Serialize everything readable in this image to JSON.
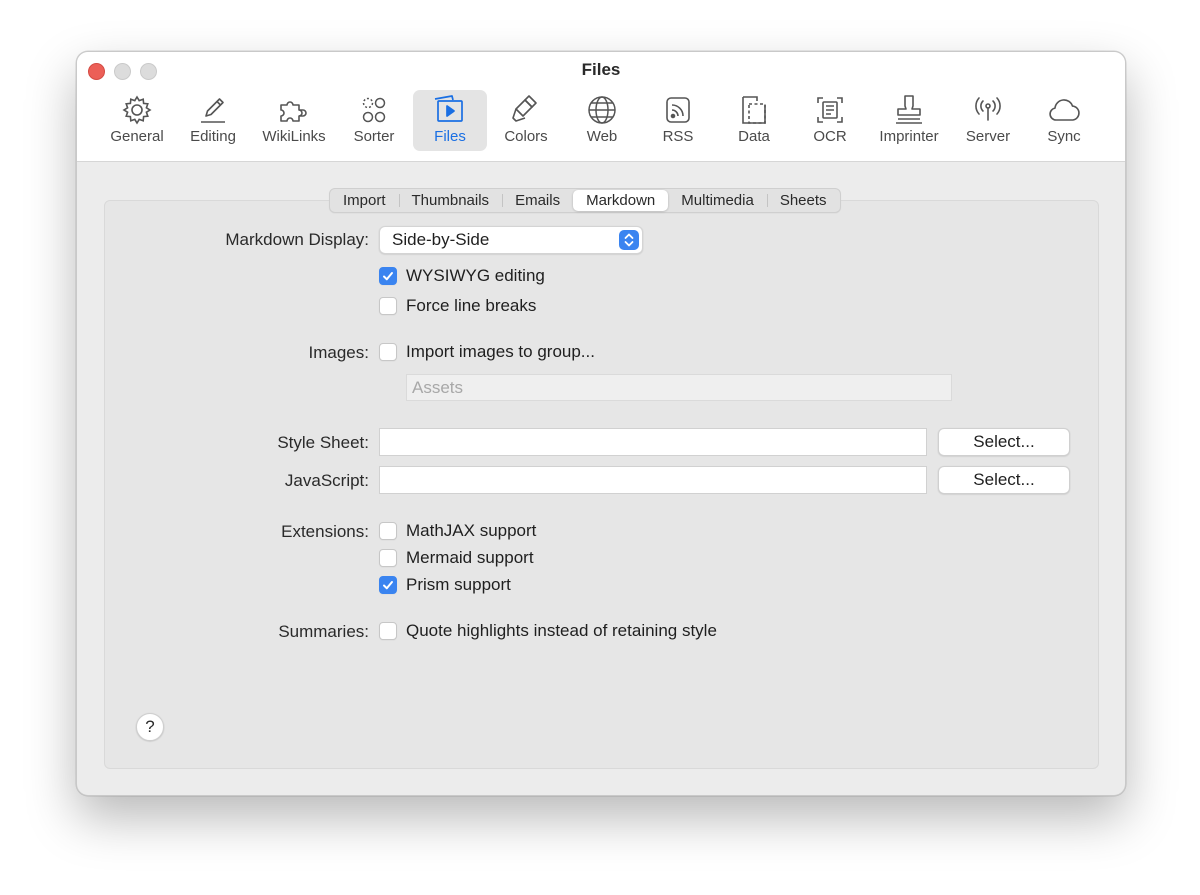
{
  "window": {
    "title": "Files"
  },
  "toolbar": {
    "items": [
      {
        "label": "General",
        "icon": "gear-icon"
      },
      {
        "label": "Editing",
        "icon": "pencil-icon"
      },
      {
        "label": "WikiLinks",
        "icon": "puzzle-icon"
      },
      {
        "label": "Sorter",
        "icon": "sorter-icon"
      },
      {
        "label": "Files",
        "icon": "files-icon",
        "selected": true
      },
      {
        "label": "Colors",
        "icon": "paintbrush-icon"
      },
      {
        "label": "Web",
        "icon": "globe-icon"
      },
      {
        "label": "RSS",
        "icon": "rss-icon"
      },
      {
        "label": "Data",
        "icon": "data-icon"
      },
      {
        "label": "OCR",
        "icon": "ocr-icon"
      },
      {
        "label": "Imprinter",
        "icon": "stamp-icon"
      },
      {
        "label": "Server",
        "icon": "antenna-icon"
      },
      {
        "label": "Sync",
        "icon": "cloud-icon"
      }
    ]
  },
  "tabs": {
    "items": [
      "Import",
      "Thumbnails",
      "Emails",
      "Markdown",
      "Multimedia",
      "Sheets"
    ],
    "active": "Markdown"
  },
  "form": {
    "markdown_display": {
      "label": "Markdown Display:",
      "value": "Side-by-Side"
    },
    "wysiwyg": {
      "label": "WYSIWYG editing",
      "checked": true
    },
    "force_breaks": {
      "label": "Force line breaks",
      "checked": false
    },
    "images": {
      "label": "Images:",
      "checkbox_label": "Import images to group...",
      "checked": false,
      "group_placeholder": "Assets"
    },
    "style_sheet": {
      "label": "Style Sheet:",
      "value": "",
      "button": "Select..."
    },
    "javascript": {
      "label": "JavaScript:",
      "value": "",
      "button": "Select..."
    },
    "extensions": {
      "label": "Extensions:",
      "items": [
        {
          "label": "MathJAX support",
          "checked": false
        },
        {
          "label": "Mermaid support",
          "checked": false
        },
        {
          "label": "Prism support",
          "checked": true
        }
      ]
    },
    "summaries": {
      "label": "Summaries:",
      "checkbox_label": "Quote highlights instead of retaining style",
      "checked": false
    }
  },
  "help": {
    "label": "?"
  },
  "colors": {
    "accent": "#3a84f0",
    "selected_label": "#1a6fe3",
    "close_button": "#ec5f57"
  }
}
